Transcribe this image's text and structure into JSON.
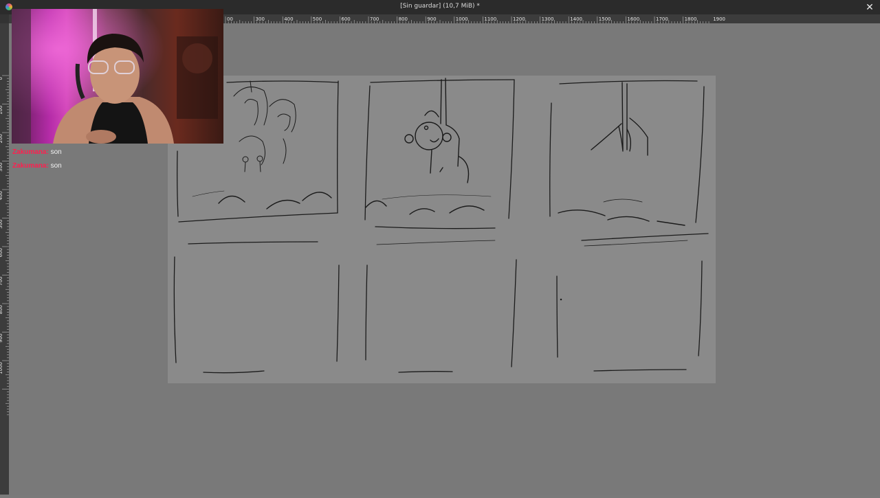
{
  "window": {
    "title": "[Sin guardar]  (10,7 MiB) *",
    "close_icon": "close-icon"
  },
  "rulers": {
    "horizontal_ticks": [
      "00",
      "300",
      "400",
      "500",
      "600",
      "700",
      "800",
      "900",
      "1000",
      "1100",
      "1200",
      "1300",
      "1400",
      "1500",
      "1600",
      "1700",
      "1800",
      "1900"
    ],
    "vertical_ticks": [
      "0",
      "100",
      "200",
      "300",
      "400",
      "500",
      "600",
      "700",
      "800",
      "900",
      "1000"
    ]
  },
  "chat": {
    "messages": [
      {
        "user": "Zakumana:",
        "text": "son"
      },
      {
        "user": "Zakumana:",
        "text": "son"
      }
    ]
  },
  "colors": {
    "titlebar": "#2b2b2b",
    "ruler": "#3c3c3c",
    "canvas_background": "#797979",
    "paper": "#8a8a8a",
    "chat_username": "#ff1f4f"
  }
}
